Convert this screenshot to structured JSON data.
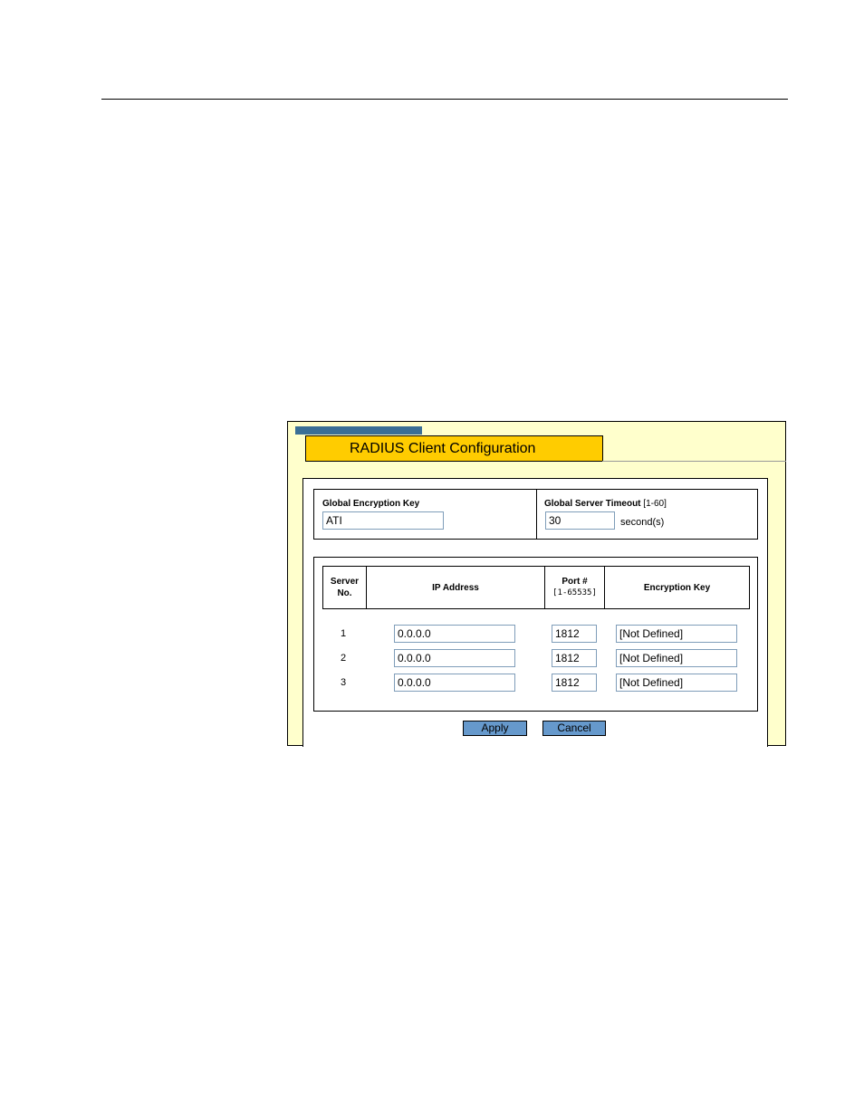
{
  "window": {
    "title": "RADIUS Client Configuration"
  },
  "global": {
    "encryption_key_label": "Global Encryption Key",
    "encryption_key_value": "ATI",
    "timeout_label": "Global Server Timeout",
    "timeout_range": "[1-60]",
    "timeout_value": "30",
    "timeout_unit": "second(s)"
  },
  "table": {
    "headers": {
      "server_no": "Server",
      "server_no_line2": "No.",
      "ip_address": "IP Address",
      "port": "Port #",
      "port_range": "[1-65535]",
      "encryption_key": "Encryption Key"
    },
    "rows": [
      {
        "no": "1",
        "ip": "0.0.0.0",
        "port": "1812",
        "key": "[Not Defined]"
      },
      {
        "no": "2",
        "ip": "0.0.0.0",
        "port": "1812",
        "key": "[Not Defined]"
      },
      {
        "no": "3",
        "ip": "0.0.0.0",
        "port": "1812",
        "key": "[Not Defined]"
      }
    ]
  },
  "buttons": {
    "apply": "Apply",
    "cancel": "Cancel"
  },
  "colors": {
    "title_tab": "#ffcc00",
    "frame_bg": "#ffffcc",
    "tab_strip": "#3a6f96",
    "button": "#6699cc"
  }
}
